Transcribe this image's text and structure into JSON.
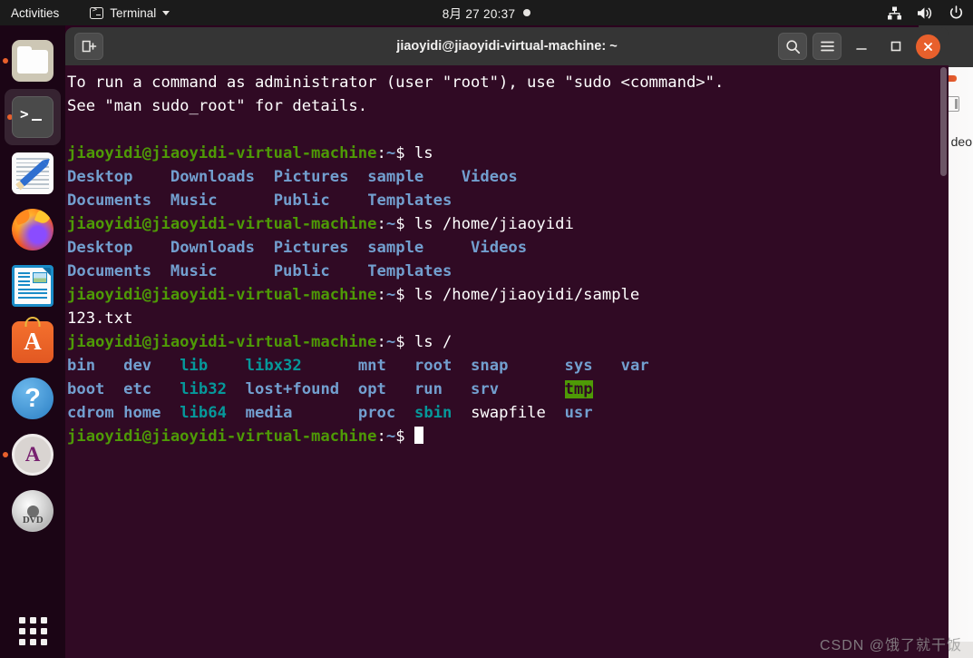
{
  "topbar": {
    "activities": "Activities",
    "app_name": "Terminal",
    "app_icon": "terminal-icon",
    "clock": "8月 27  20:37",
    "tray_icons": [
      "network-icon",
      "volume-icon",
      "power-icon"
    ]
  },
  "dock": {
    "items": [
      {
        "name": "files",
        "label": "Files",
        "icon": "files-icon",
        "running": true,
        "focused": false
      },
      {
        "name": "terminal",
        "label": "Terminal",
        "icon": "terminal-icon",
        "running": true,
        "focused": true
      },
      {
        "name": "text-editor",
        "label": "Text Editor",
        "icon": "text-editor-icon",
        "running": false,
        "focused": false
      },
      {
        "name": "firefox",
        "label": "Firefox",
        "icon": "firefox-icon",
        "running": false,
        "focused": false
      },
      {
        "name": "libreoffice-writer",
        "label": "LibreOffice Writer",
        "icon": "document-icon",
        "running": false,
        "focused": false
      },
      {
        "name": "ubuntu-software",
        "label": "Ubuntu Software",
        "icon": "software-bag-icon",
        "running": false,
        "focused": false
      },
      {
        "name": "help",
        "label": "Help",
        "icon": "question-mark-icon",
        "running": false,
        "focused": false
      },
      {
        "name": "software-updater",
        "label": "Software Updater",
        "icon": "update-icon",
        "running": true,
        "focused": false
      },
      {
        "name": "dvd-drive",
        "label": "DVD",
        "icon": "dvd-disc-icon",
        "running": false,
        "focused": false
      }
    ],
    "dvd_label": "DVD",
    "software_glyph": "A",
    "help_glyph": "?",
    "updater_glyph": "A",
    "show_apps_label": "Show Applications"
  },
  "terminal": {
    "title": "jiaoyidi@jiaoyidi-virtual-machine: ~",
    "new_tab_label": "New Tab",
    "search_label": "Search",
    "menu_label": "Menu",
    "minimize_label": "Minimize",
    "maximize_label": "Maximize",
    "close_label": "Close",
    "prompt": "jiaoyidi@jiaoyidi-virtual-machine",
    "prompt_path": "~",
    "prompt_sigil": "$",
    "colors": {
      "background": "#300a24",
      "foreground": "#ffffff",
      "prompt_green": "#4e9a06",
      "dir_blue": "#729fcf",
      "link_cyan": "#06989a",
      "sticky_bg": "#4e9a06",
      "titlebar": "#353535",
      "close_button": "#e8602c"
    },
    "lines": [
      {
        "type": "text",
        "segments": [
          {
            "color": "white",
            "text": "To run a command as administrator (user \"root\"), use \"sudo <command>\"."
          }
        ]
      },
      {
        "type": "text",
        "segments": [
          {
            "color": "white",
            "text": "See \"man sudo_root\" for details."
          }
        ]
      },
      {
        "type": "blank",
        "segments": []
      },
      {
        "type": "prompt",
        "command": "ls"
      },
      {
        "type": "ls",
        "segments": [
          {
            "color": "dirblue",
            "text": "Desktop"
          },
          {
            "color": "white",
            "text": "    "
          },
          {
            "color": "dirblue",
            "text": "Downloads"
          },
          {
            "color": "white",
            "text": "  "
          },
          {
            "color": "dirblue",
            "text": "Pictures"
          },
          {
            "color": "white",
            "text": "  "
          },
          {
            "color": "dirblue",
            "text": "sample"
          },
          {
            "color": "white",
            "text": "    "
          },
          {
            "color": "dirblue",
            "text": "Videos"
          }
        ]
      },
      {
        "type": "ls",
        "segments": [
          {
            "color": "dirblue",
            "text": "Documents"
          },
          {
            "color": "white",
            "text": "  "
          },
          {
            "color": "dirblue",
            "text": "Music"
          },
          {
            "color": "white",
            "text": "      "
          },
          {
            "color": "dirblue",
            "text": "Public"
          },
          {
            "color": "white",
            "text": "    "
          },
          {
            "color": "dirblue",
            "text": "Templates"
          }
        ]
      },
      {
        "type": "prompt",
        "command": "ls /home/jiaoyidi"
      },
      {
        "type": "ls",
        "segments": [
          {
            "color": "dirblue",
            "text": "Desktop"
          },
          {
            "color": "white",
            "text": "    "
          },
          {
            "color": "dirblue",
            "text": "Downloads"
          },
          {
            "color": "white",
            "text": "  "
          },
          {
            "color": "dirblue",
            "text": "Pictures"
          },
          {
            "color": "white",
            "text": "  "
          },
          {
            "color": "dirblue",
            "text": "sample"
          },
          {
            "color": "white",
            "text": "     "
          },
          {
            "color": "dirblue",
            "text": "Videos"
          }
        ]
      },
      {
        "type": "ls",
        "segments": [
          {
            "color": "dirblue",
            "text": "Documents"
          },
          {
            "color": "white",
            "text": "  "
          },
          {
            "color": "dirblue",
            "text": "Music"
          },
          {
            "color": "white",
            "text": "      "
          },
          {
            "color": "dirblue",
            "text": "Public"
          },
          {
            "color": "white",
            "text": "    "
          },
          {
            "color": "dirblue",
            "text": "Templates"
          }
        ]
      },
      {
        "type": "prompt",
        "command": "ls /home/jiaoyidi/sample"
      },
      {
        "type": "ls",
        "segments": [
          {
            "color": "white",
            "text": "123.txt"
          }
        ]
      },
      {
        "type": "prompt",
        "command": "ls /"
      },
      {
        "type": "ls",
        "segments": [
          {
            "color": "dirblue",
            "text": "bin"
          },
          {
            "color": "white",
            "text": "   "
          },
          {
            "color": "dirblue",
            "text": "dev"
          },
          {
            "color": "white",
            "text": "   "
          },
          {
            "color": "cyan",
            "text": "lib"
          },
          {
            "color": "white",
            "text": "    "
          },
          {
            "color": "cyan",
            "text": "libx32"
          },
          {
            "color": "white",
            "text": "      "
          },
          {
            "color": "dirblue",
            "text": "mnt"
          },
          {
            "color": "white",
            "text": "   "
          },
          {
            "color": "dirblue",
            "text": "root"
          },
          {
            "color": "white",
            "text": "  "
          },
          {
            "color": "dirblue",
            "text": "snap"
          },
          {
            "color": "white",
            "text": "      "
          },
          {
            "color": "dirblue",
            "text": "sys"
          },
          {
            "color": "white",
            "text": "   "
          },
          {
            "color": "dirblue",
            "text": "var"
          }
        ]
      },
      {
        "type": "ls",
        "segments": [
          {
            "color": "dirblue",
            "text": "boot"
          },
          {
            "color": "white",
            "text": "  "
          },
          {
            "color": "dirblue",
            "text": "etc"
          },
          {
            "color": "white",
            "text": "   "
          },
          {
            "color": "cyan",
            "text": "lib32"
          },
          {
            "color": "white",
            "text": "  "
          },
          {
            "color": "dirblue",
            "text": "lost+found"
          },
          {
            "color": "white",
            "text": "  "
          },
          {
            "color": "dirblue",
            "text": "opt"
          },
          {
            "color": "white",
            "text": "   "
          },
          {
            "color": "dirblue",
            "text": "run"
          },
          {
            "color": "white",
            "text": "   "
          },
          {
            "color": "dirblue",
            "text": "srv"
          },
          {
            "color": "white",
            "text": "       "
          },
          {
            "color": "sticky",
            "text": "tmp"
          }
        ]
      },
      {
        "type": "ls",
        "segments": [
          {
            "color": "dirblue",
            "text": "cdrom"
          },
          {
            "color": "white",
            "text": " "
          },
          {
            "color": "dirblue",
            "text": "home"
          },
          {
            "color": "white",
            "text": "  "
          },
          {
            "color": "cyan",
            "text": "lib64"
          },
          {
            "color": "white",
            "text": "  "
          },
          {
            "color": "dirblue",
            "text": "media"
          },
          {
            "color": "white",
            "text": "       "
          },
          {
            "color": "dirblue",
            "text": "proc"
          },
          {
            "color": "white",
            "text": "  "
          },
          {
            "color": "cyan",
            "text": "sbin"
          },
          {
            "color": "white",
            "text": "  "
          },
          {
            "color": "white",
            "text": "swapfile"
          },
          {
            "color": "white",
            "text": "  "
          },
          {
            "color": "dirblue",
            "text": "usr"
          }
        ]
      },
      {
        "type": "prompt-cursor",
        "command": ""
      }
    ]
  },
  "background_window": {
    "label": "deo"
  },
  "watermark": "CSDN @饿了就干饭"
}
